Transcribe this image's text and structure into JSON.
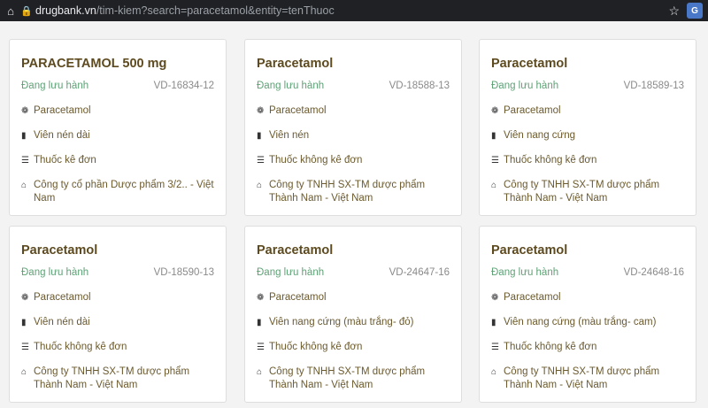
{
  "browser": {
    "url_host": "drugbank.vn",
    "url_rest": "/tim-kiem?search=paracetamol&entity=tenThuoc"
  },
  "cards": [
    {
      "title": "PARACETAMOL 500 mg",
      "status": "Đang lưu hành",
      "code": "VD-16834-12",
      "ingredient": "Paracetamol",
      "form": "Viên nén dài",
      "category": "Thuốc kê đơn",
      "company": "Công ty cổ phần Dược phẩm 3/2.. - Việt Nam"
    },
    {
      "title": "Paracetamol",
      "status": "Đang lưu hành",
      "code": "VD-18588-13",
      "ingredient": "Paracetamol",
      "form": "Viên nén",
      "category": "Thuốc không kê đơn",
      "company": "Công ty TNHH SX-TM dược phẩm Thành Nam - Việt Nam"
    },
    {
      "title": "Paracetamol",
      "status": "Đang lưu hành",
      "code": "VD-18589-13",
      "ingredient": "Paracetamol",
      "form": "Viên nang cứng",
      "category": "Thuốc không kê đơn",
      "company": "Công ty TNHH SX-TM dược phẩm Thành Nam - Việt Nam"
    },
    {
      "title": "Paracetamol",
      "status": "Đang lưu hành",
      "code": "VD-18590-13",
      "ingredient": "Paracetamol",
      "form": "Viên nén dài",
      "category": "Thuốc không kê đơn",
      "company": "Công ty TNHH SX-TM dược phẩm Thành Nam - Việt Nam"
    },
    {
      "title": "Paracetamol",
      "status": "Đang lưu hành",
      "code": "VD-24647-16",
      "ingredient": "Paracetamol",
      "form": "Viên nang cứng (màu trắng- đỏ)",
      "category": "Thuốc không kê đơn",
      "company": "Công ty TNHH SX-TM dược phẩm Thành Nam - Việt Nam"
    },
    {
      "title": "Paracetamol",
      "status": "Đang lưu hành",
      "code": "VD-24648-16",
      "ingredient": "Paracetamol",
      "form": "Viên nang cứng (màu trắng- cam)",
      "category": "Thuốc không kê đơn",
      "company": "Công ty TNHH SX-TM dược phẩm Thành Nam - Việt Nam"
    }
  ],
  "colors": {
    "status": "#5ea276",
    "title": "#5d4a1f",
    "text": "#6b5a2e"
  }
}
